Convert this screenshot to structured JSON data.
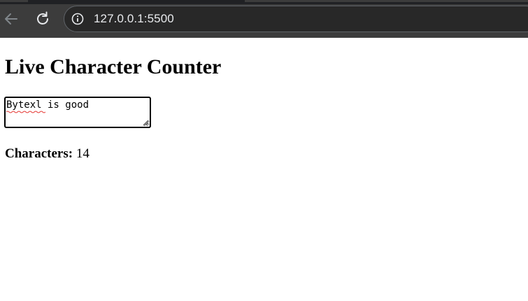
{
  "browser": {
    "url": "127.0.0.1:5500",
    "back_icon": "arrow-left-icon",
    "reload_icon": "reload-icon",
    "site_info_icon": "info-circle-icon"
  },
  "page": {
    "title": "Live Character Counter",
    "textarea_value": "Bytexl is good",
    "counter_label": "Characters:",
    "counter_value": "14"
  },
  "colors": {
    "chrome_bg": "#3c3c3c",
    "omnibox_bg": "#282828",
    "page_bg": "#ffffff",
    "spellcheck": "#e53935"
  }
}
